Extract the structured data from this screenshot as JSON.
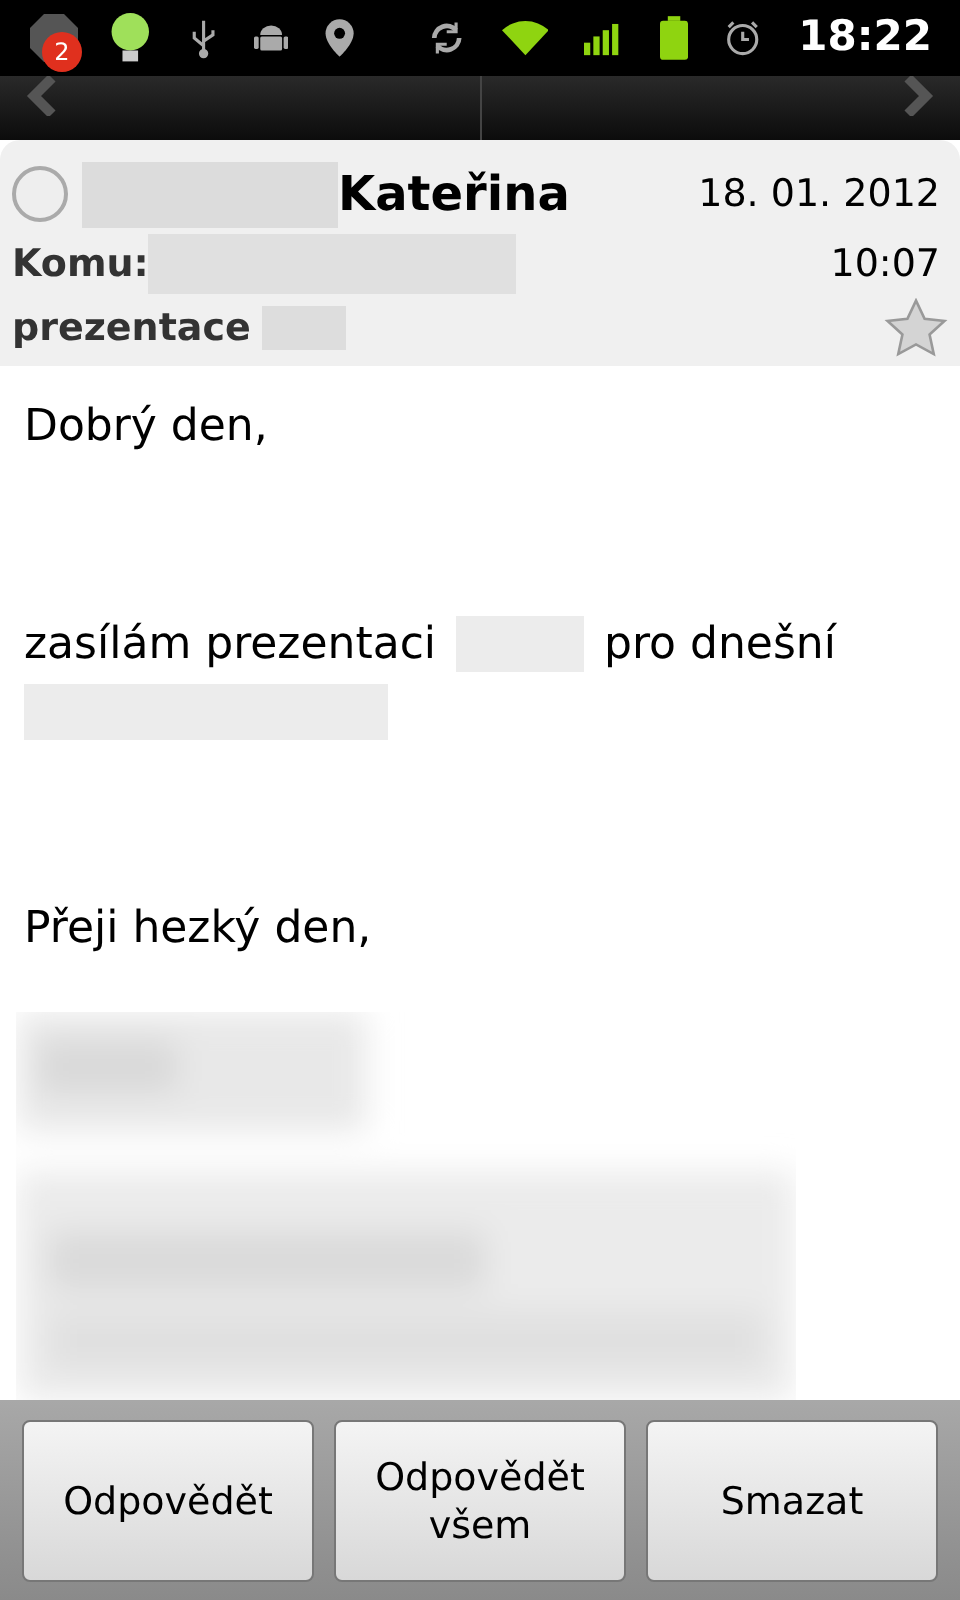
{
  "status_bar": {
    "notification_count": "2",
    "time": "18:22"
  },
  "message": {
    "selected": false,
    "sender": "Kateřina",
    "date": "18. 01. 2012",
    "time": "10:07",
    "to_label": "Komu:",
    "subject": "prezentace",
    "starred": false
  },
  "body": [
    {
      "kind": "line",
      "parts": [
        {
          "kind": "text",
          "text": "Dobrý den,"
        }
      ]
    },
    {
      "kind": "gap"
    },
    {
      "kind": "line",
      "parts": [
        {
          "kind": "text",
          "text": "zasílám prezentaci"
        },
        {
          "kind": "redacted"
        },
        {
          "kind": "text",
          "text": "pro dnešní"
        }
      ]
    },
    {
      "kind": "line",
      "parts": [
        {
          "kind": "redacted"
        }
      ]
    },
    {
      "kind": "gap"
    },
    {
      "kind": "line",
      "parts": [
        {
          "kind": "text",
          "text": "Přeji hezký den,"
        }
      ]
    },
    {
      "kind": "signature"
    }
  ],
  "buttons": [
    {
      "label": "Odpovědět"
    },
    {
      "label": "Odpovědět všem"
    },
    {
      "label": "Smazat"
    }
  ]
}
